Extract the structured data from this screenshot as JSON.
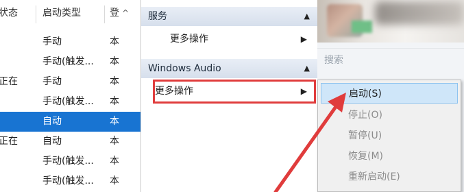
{
  "services_list": {
    "headers": {
      "status": "状态",
      "startup_type": "启动类型",
      "logon": "登"
    },
    "sort_indicator": "^",
    "rows": [
      {
        "status": "",
        "startup_type": "手动",
        "logon": "本",
        "selected": false
      },
      {
        "status": "",
        "startup_type": "手动(触发...",
        "logon": "本",
        "selected": false
      },
      {
        "status": "正在",
        "startup_type": "手动",
        "logon": "本",
        "selected": false
      },
      {
        "status": "",
        "startup_type": "手动(触发...",
        "logon": "本",
        "selected": false
      },
      {
        "status": "",
        "startup_type": "自动",
        "logon": "本",
        "selected": true
      },
      {
        "status": "正在",
        "startup_type": "自动",
        "logon": "本",
        "selected": false
      },
      {
        "status": "",
        "startup_type": "手动(触发...",
        "logon": "本",
        "selected": false
      },
      {
        "status": "",
        "startup_type": "手动(触发...",
        "logon": "本",
        "selected": false
      }
    ]
  },
  "actions": {
    "section1_title": "服务",
    "section1_more": "更多操作",
    "section2_title": "Windows Audio",
    "section2_more": "更多操作"
  },
  "right_panel": {
    "search_placeholder": "搜索"
  },
  "context_menu": {
    "items": [
      {
        "label": "启动(S)",
        "active": true
      },
      {
        "label": "停止(O)",
        "active": false
      },
      {
        "label": "暂停(U)",
        "active": false
      },
      {
        "label": "恢复(M)",
        "active": false
      },
      {
        "label": "重新启动(E)",
        "active": false
      }
    ]
  },
  "icons": {
    "collapse": "triangle-up-icon",
    "submenu": "triangle-right-icon"
  },
  "colors": {
    "selection": "#1874d2",
    "header_gradient": "#d6dfec",
    "menu_highlight": "#cfe6f9",
    "annotation_red": "#e03c3c"
  }
}
